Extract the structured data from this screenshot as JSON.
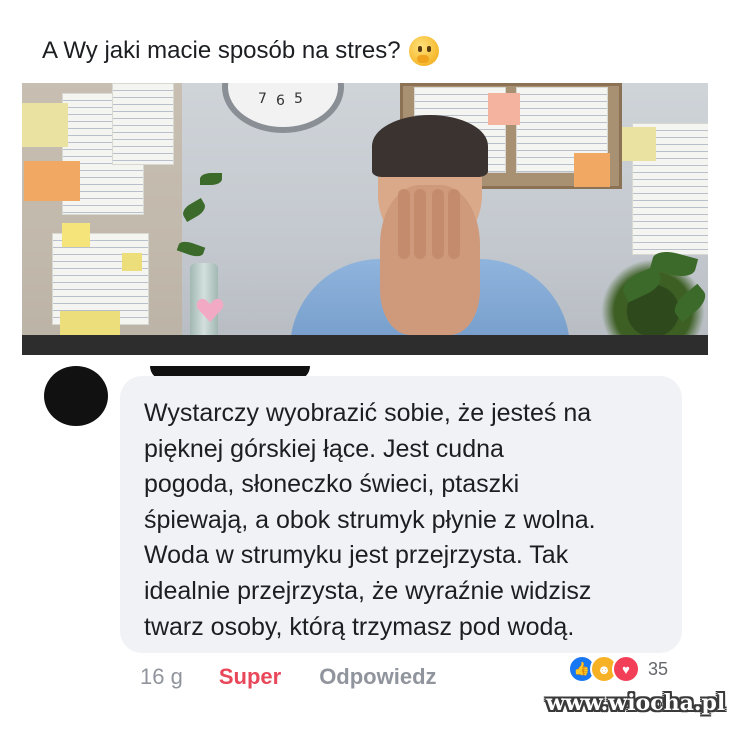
{
  "post": {
    "title": "A Wy jaki macie sposób na stres?",
    "title_emoji": "thinking-face-icon"
  },
  "photo": {
    "clock_numbers": [
      "7",
      "6",
      "5"
    ],
    "description_icon": "stressed-office-worker-photo"
  },
  "comment": {
    "text": "Wystarczy wyobrazić sobie, że jesteś na\npięknej górskiej łące. Jest cudna\npogoda, słoneczko świeci, ptaszki\nśpiewają, a obok strumyk płynie z wolna.\nWoda w strumyku jest przejrzysta. Tak\nidealnie przejrzysta, że wyraźnie widzisz\ntwarz osoby, którą trzymasz pod wodą.",
    "time": "16 g",
    "reaction_label": "Super",
    "reply_label": "Odpowiedz",
    "reaction_count": "35",
    "reaction_icons": [
      "like-icon",
      "haha-icon",
      "love-icon"
    ]
  },
  "watermark": "www.wiocha.pl",
  "colors": {
    "super": "#e9475a",
    "bubble": "#f0f2f5",
    "like": "#1877f2",
    "love": "#f33e58",
    "haha": "#f7b125"
  }
}
